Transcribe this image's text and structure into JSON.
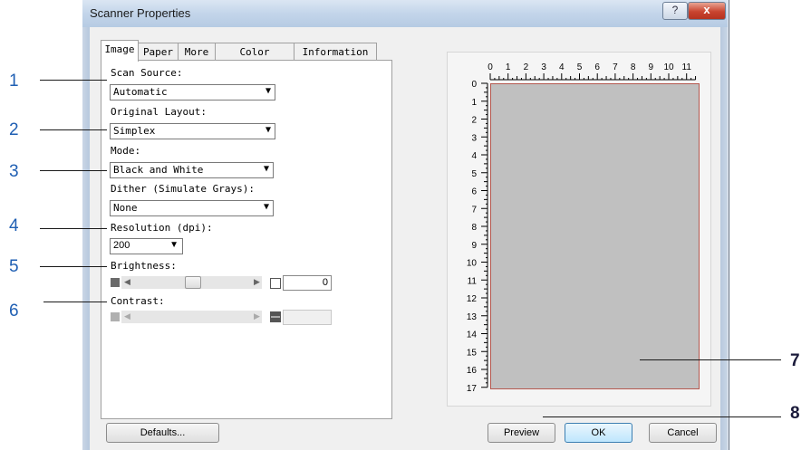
{
  "window": {
    "title": "Scanner Properties",
    "help_label": "?",
    "close_label": "x"
  },
  "tabs": [
    {
      "label": "Image",
      "active": true
    },
    {
      "label": "Paper",
      "active": false
    },
    {
      "label": "More",
      "active": false
    },
    {
      "label": "Color Dropout",
      "active": false
    },
    {
      "label": "Information",
      "active": false
    }
  ],
  "image_tab": {
    "scan_source": {
      "label": "Scan Source:",
      "value": "Automatic"
    },
    "original_layout": {
      "label": "Original Layout:",
      "value": "Simplex"
    },
    "mode": {
      "label": "Mode:",
      "value": "Black and White"
    },
    "dither": {
      "label": "Dither (Simulate Grays):",
      "value": "None"
    },
    "resolution": {
      "label": "Resolution (dpi):",
      "value": "200"
    },
    "brightness": {
      "label": "Brightness:",
      "value": "0",
      "level": 0.5
    },
    "contrast": {
      "label": "Contrast:",
      "value": ""
    }
  },
  "preview": {
    "h_ruler": [
      "0",
      "1",
      "2",
      "3",
      "4",
      "5",
      "6",
      "7",
      "8",
      "9",
      "10",
      "11"
    ],
    "v_ruler": [
      "0",
      "1",
      "2",
      "3",
      "4",
      "5",
      "6",
      "7",
      "8",
      "9",
      "10",
      "11",
      "12",
      "13",
      "14",
      "15",
      "16",
      "17"
    ],
    "paper_color": "#c0c0c0"
  },
  "buttons": {
    "defaults": "Defaults...",
    "preview": "Preview",
    "ok": "OK",
    "cancel": "Cancel"
  },
  "callouts": [
    "1",
    "2",
    "3",
    "4",
    "5",
    "6",
    "7",
    "8"
  ]
}
